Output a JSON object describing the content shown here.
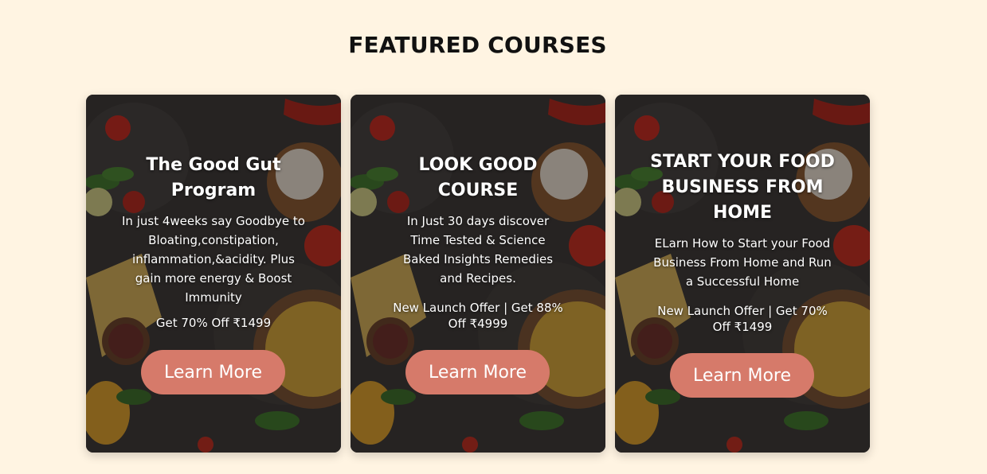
{
  "section": {
    "title": "FEATURED COURSES"
  },
  "courses": [
    {
      "title": "The Good Gut Program",
      "description": "In just 4weeks say Goodbye to Bloating,constipation, inflammation,&acidity. Plus gain more energy & Boost Immunity",
      "offer": "Get 70% Off ₹1499",
      "button_label": "Learn More"
    },
    {
      "title": "LOOK GOOD COURSE",
      "description": "In Just 30 days discover Time Tested & Science Baked Insights Remedies and Recipes.",
      "offer": "New Launch Offer | Get 88% Off ₹4999",
      "button_label": "Learn More"
    },
    {
      "title": "START YOUR FOOD BUSINESS FROM HOME",
      "description": "ELarn How to Start your Food Business From Home and Run a Successful Home",
      "offer": "New Launch Offer | Get 70% Off ₹1499",
      "button_label": "Learn More"
    }
  ],
  "colors": {
    "page_background": "#fff4e2",
    "button_background": "#d67a6a",
    "card_text": "#ffffff"
  }
}
